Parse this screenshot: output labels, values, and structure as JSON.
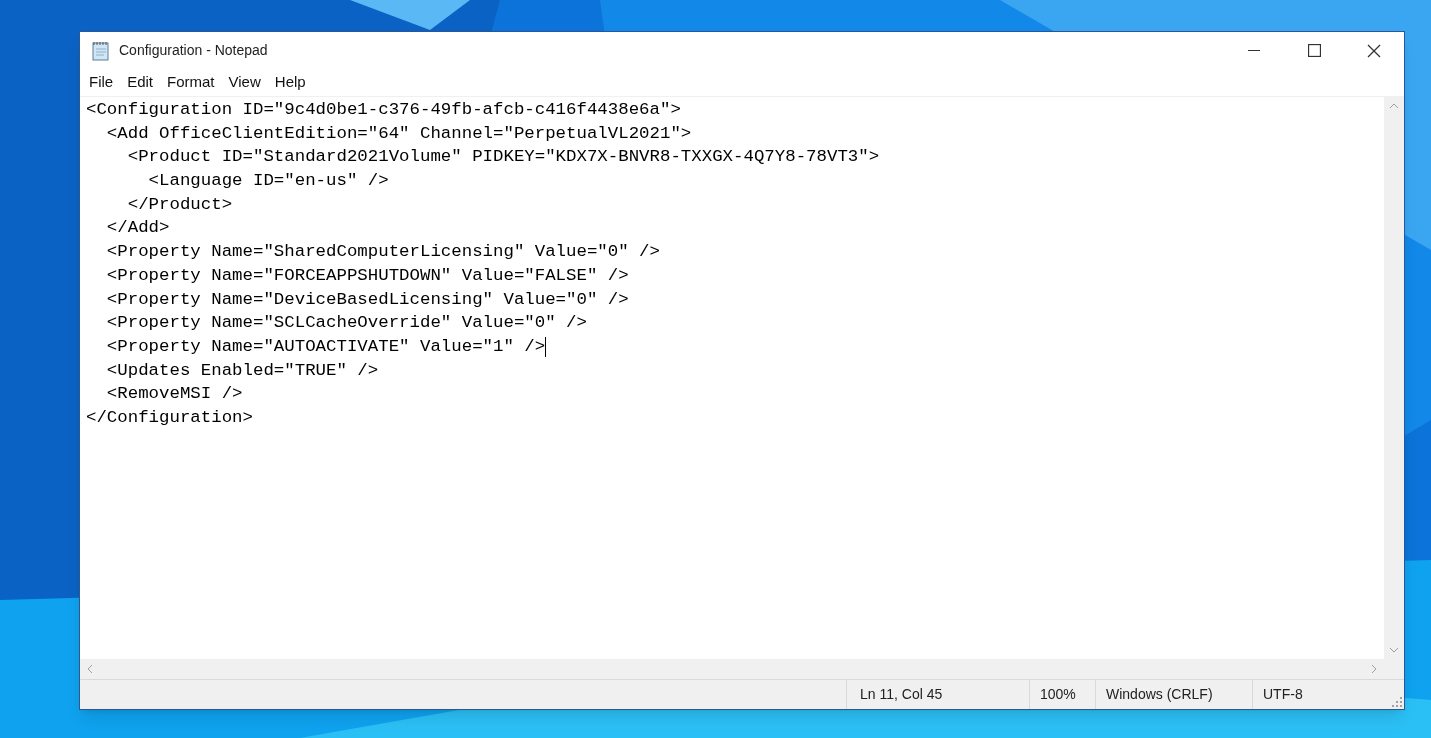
{
  "window": {
    "title": "Configuration - Notepad"
  },
  "menu": [
    "File",
    "Edit",
    "Format",
    "View",
    "Help"
  ],
  "editor": {
    "lines": [
      {
        "text": "<Configuration ID=\"9c4d0be1-c376-49fb-afcb-c416f4438e6a\">",
        "caret": false
      },
      {
        "text": "  <Add OfficeClientEdition=\"64\" Channel=\"PerpetualVL2021\">",
        "caret": false
      },
      {
        "text": "    <Product ID=\"Standard2021Volume\" PIDKEY=\"KDX7X-BNVR8-TXXGX-4Q7Y8-78VT3\">",
        "caret": false
      },
      {
        "text": "      <Language ID=\"en-us\" />",
        "caret": false
      },
      {
        "text": "    </Product>",
        "caret": false
      },
      {
        "text": "  </Add>",
        "caret": false
      },
      {
        "text": "  <Property Name=\"SharedComputerLicensing\" Value=\"0\" />",
        "caret": false
      },
      {
        "text": "  <Property Name=\"FORCEAPPSHUTDOWN\" Value=\"FALSE\" />",
        "caret": false
      },
      {
        "text": "  <Property Name=\"DeviceBasedLicensing\" Value=\"0\" />",
        "caret": false
      },
      {
        "text": "  <Property Name=\"SCLCacheOverride\" Value=\"0\" />",
        "caret": false
      },
      {
        "text": "  <Property Name=\"AUTOACTIVATE\" Value=\"1\" />",
        "caret": true
      },
      {
        "text": "  <Updates Enabled=\"TRUE\" />",
        "caret": false
      },
      {
        "text": "  <RemoveMSI />",
        "caret": false
      },
      {
        "text": "</Configuration>",
        "caret": false
      }
    ]
  },
  "status_bar": {
    "position": "Ln 11, Col 45",
    "zoom": "100%",
    "line_endings": "Windows (CRLF)",
    "encoding": "UTF-8"
  }
}
